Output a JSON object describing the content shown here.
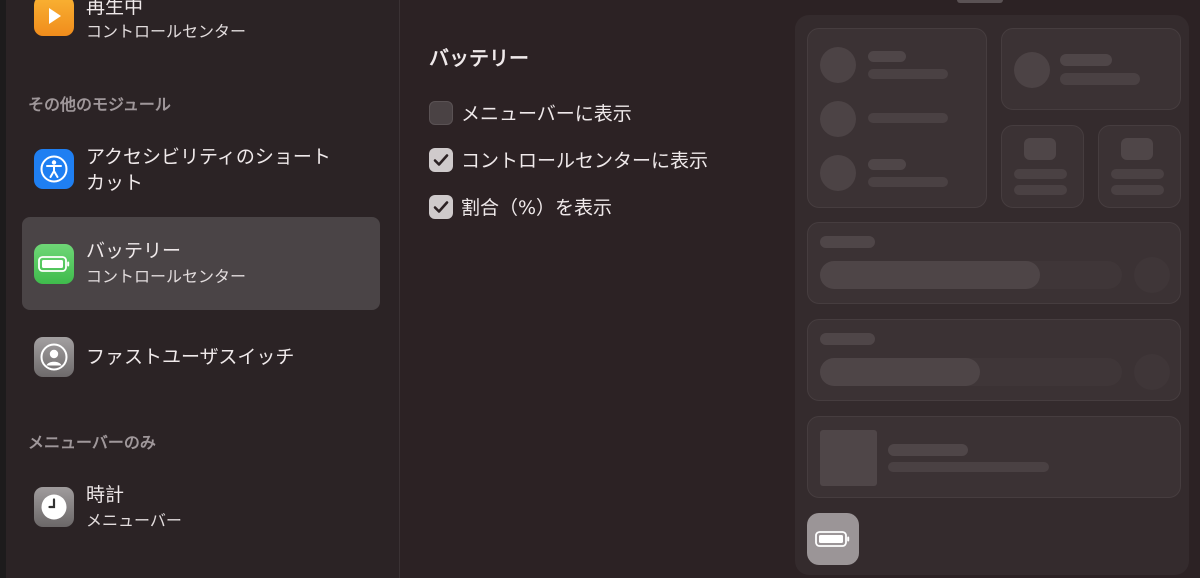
{
  "sidebar": {
    "now_playing": {
      "title": "再生中",
      "subtitle": "コントロールセンター",
      "icon": "play-icon",
      "color": "#f5a623"
    },
    "section_other": "その他のモジュール",
    "accessibility": {
      "title_line1": "アクセシビリティのショート",
      "title_line2": "カット",
      "icon": "accessibility-icon",
      "color": "#1c7cf3"
    },
    "battery": {
      "title": "バッテリー",
      "subtitle": "コントロールセンター",
      "icon": "battery-icon",
      "color": "#4cc85a"
    },
    "fast_user_switch": {
      "title": "ファストユーザスイッチ",
      "icon": "user-icon",
      "color": "#8e8a8b"
    },
    "section_menubar_only": "メニューバーのみ",
    "clock": {
      "title": "時計",
      "subtitle": "メニューバー",
      "icon": "clock-icon",
      "color": "#8e8a8b"
    }
  },
  "main": {
    "title": "バッテリー",
    "options": [
      {
        "label": "メニューバーに表示",
        "checked": false
      },
      {
        "label": "コントロールセンターに表示",
        "checked": true
      },
      {
        "label": "割合（%）を表示",
        "checked": true
      }
    ]
  },
  "preview": {
    "slider1_fill": 0.73,
    "slider2_fill": 0.53,
    "battery_button_icon": "battery-icon"
  }
}
